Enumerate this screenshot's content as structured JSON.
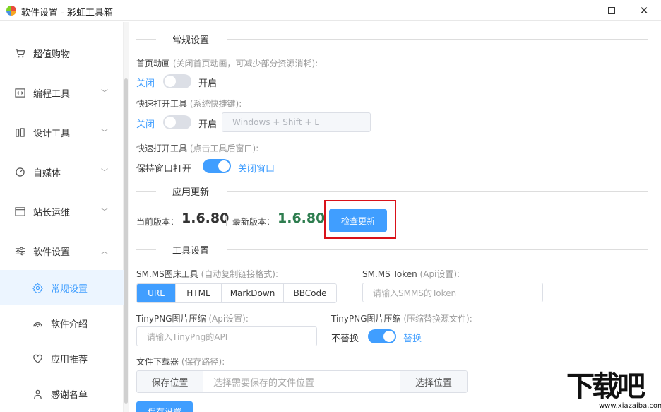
{
  "window": {
    "title": "软件设置 - 彩虹工具箱",
    "minimize": "—",
    "maximize": "",
    "close": "✕"
  },
  "sidebar": {
    "items": [
      {
        "label": "超值购物",
        "icon": "cart-icon"
      },
      {
        "label": "编程工具",
        "icon": "code-icon"
      },
      {
        "label": "设计工具",
        "icon": "design-icon"
      },
      {
        "label": "自媒体",
        "icon": "media-icon"
      },
      {
        "label": "站长运维",
        "icon": "server-icon"
      },
      {
        "label": "软件设置",
        "icon": "sliders-icon"
      }
    ],
    "subitems": [
      {
        "label": "常规设置",
        "icon": "gear-icon",
        "active": true
      },
      {
        "label": "软件介绍",
        "icon": "signal-icon"
      },
      {
        "label": "应用推荐",
        "icon": "heart-icon"
      },
      {
        "label": "感谢名单",
        "icon": "person-icon"
      }
    ]
  },
  "general": {
    "section_title": "常规设置",
    "anim_label": "首页动画",
    "anim_hint": "(关闭首页动画，可减少部分资源消耗):",
    "anim_off": "关闭",
    "anim_on": "开启",
    "quick_label": "快速打开工具",
    "quick_hint": "(系统快捷键):",
    "quick_off": "关闭",
    "quick_on": "开启",
    "hotkey_placeholder": "Windows + Shift + L",
    "after_label": "快速打开工具",
    "after_hint": "(点击工具后窗口):",
    "after_keep": "保持窗口打开",
    "after_close": "关闭窗口"
  },
  "update": {
    "section_title": "应用更新",
    "current_label": "当前版本：",
    "current_version": "1.6.80",
    "latest_label": "最新版本：",
    "latest_version": "1.6.80",
    "check_button": "检查更新"
  },
  "tools": {
    "section_title": "工具设置",
    "smms_label": "SM.MS图床工具",
    "smms_hint": "(自动复制链接格式):",
    "formats": [
      "URL",
      "HTML",
      "MarkDown",
      "BBCode"
    ],
    "selected_format": "URL",
    "token_label": "SM.MS Token",
    "token_hint": "(Api设置):",
    "token_placeholder": "请输入SMMS的Token",
    "tiny_label": "TinyPNG图片压缩",
    "tiny_hint": "(Api设置):",
    "tiny_placeholder": "请输入TinyPng的API",
    "replace_label": "TinyPNG图片压缩",
    "replace_hint": "(压缩替换源文件):",
    "replace_off": "不替换",
    "replace_on": "替换",
    "dl_label": "文件下载器",
    "dl_hint": "(保存路径):",
    "dl_save": "保存位置",
    "dl_placeholder": "选择需要保存的文件位置",
    "dl_choose": "选择位置",
    "save_button": "保存设置"
  },
  "watermark": {
    "big": "下载吧",
    "small": "www.xiazaiba.com"
  },
  "colors": {
    "accent": "#409eff",
    "latest_version": "#2e7d4f",
    "highlight": "#d9121a"
  }
}
